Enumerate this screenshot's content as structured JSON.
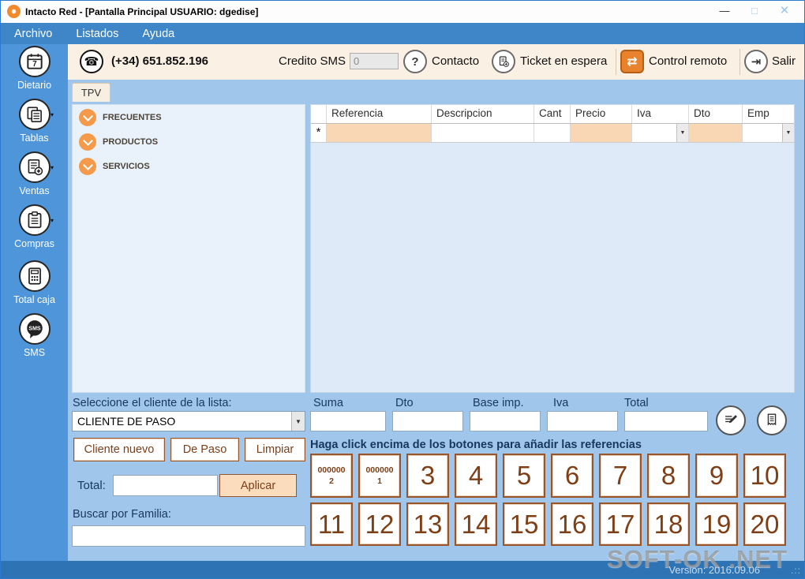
{
  "window": {
    "title": "Intacto Red - [Pantalla Principal USUARIO: dgedise]",
    "minimize": "—",
    "maximize": "□",
    "close": "✕"
  },
  "menu": {
    "items": [
      {
        "label": "Archivo"
      },
      {
        "label": "Listados"
      },
      {
        "label": "Ayuda"
      }
    ]
  },
  "toolbar": {
    "phone_number": "(+34) 651.852.196",
    "credito_sms_label": "Credito SMS",
    "credito_sms_value": "0",
    "contacto_label": "Contacto",
    "ticket_label": "Ticket en espera",
    "control_remoto_label": "Control remoto",
    "salir_label": "Salir"
  },
  "sidebar": {
    "items": [
      {
        "label": "Dietario"
      },
      {
        "label": "Tablas"
      },
      {
        "label": "Ventas"
      },
      {
        "label": "Compras"
      },
      {
        "label": "Total caja"
      },
      {
        "label": "SMS"
      }
    ]
  },
  "tabs": {
    "tpv": "TPV"
  },
  "tree": {
    "items": [
      {
        "label": "FRECUENTES"
      },
      {
        "label": "PRODUCTOS"
      },
      {
        "label": "SERVICIOS"
      }
    ]
  },
  "table": {
    "columns": [
      "Referencia",
      "Descripcion",
      "Cant",
      "Precio",
      "Iva",
      "Dto",
      "Emp"
    ],
    "new_row_marker": "*"
  },
  "totals": {
    "suma_label": "Suma",
    "dto_label": "Dto",
    "base_label": "Base imp.",
    "iva_label": "Iva",
    "total_label": "Total"
  },
  "customer": {
    "select_label": "Seleccione el cliente de la lista:",
    "selected_client": "CLIENTE DE PASO",
    "cliente_nuevo": "Cliente nuevo",
    "de_paso": "De Paso",
    "limpiar": "Limpiar",
    "total_label": "Total:",
    "aplicar": "Aplicar",
    "familia_label": "Buscar por Familia:"
  },
  "references": {
    "hint": "Haga click encima de los botones para añadir las referencias",
    "row1": [
      "000000\n2",
      "000000\n1",
      "3",
      "4",
      "5",
      "6",
      "7",
      "8",
      "9",
      "10"
    ],
    "row2": [
      "11",
      "12",
      "13",
      "14",
      "15",
      "16",
      "17",
      "18",
      "19",
      "20"
    ]
  },
  "statusbar": {
    "version": "Version: 2016.09.06",
    "grip": ".::"
  },
  "watermark": "SOFT-OK .NET",
  "colors": {
    "accent_orange": "#F59A4B",
    "menu_blue": "#3E86C7",
    "sidebar_blue": "#4E95DA",
    "content_blue": "#A0C7EB",
    "panel_light_blue": "#E9F2FB",
    "toolbar_cream": "#FAF0E4",
    "cell_orange": "#F9D6B4",
    "button_brown": "#99552A",
    "text_brown": "#7E3F16",
    "label_navy": "#17375E",
    "statusbar_blue": "#2E73B4"
  }
}
